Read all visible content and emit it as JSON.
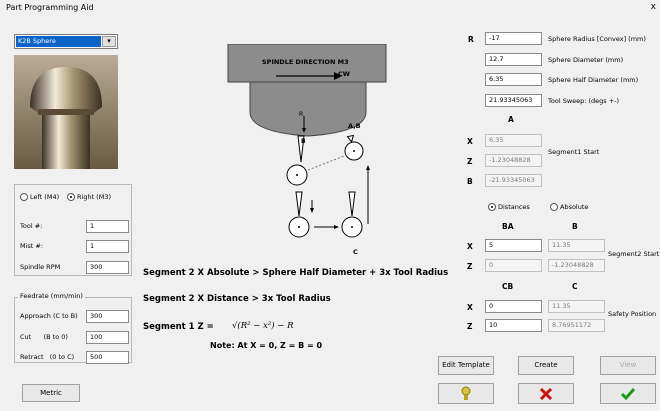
{
  "window": {
    "title": "Part Programming Aid",
    "close_glyph": "x"
  },
  "tool_select": {
    "value": "K2B Sphere"
  },
  "left_panel": {
    "left_radio": "Left (M4)",
    "right_radio": "Right (M3)",
    "fields": [
      {
        "label": "Tool #:",
        "value": "1"
      },
      {
        "label": "Mist #:",
        "value": "1"
      },
      {
        "label": "Spindle RPM",
        "value": "300"
      }
    ],
    "feedrate": {
      "title": "Feedrate (mm/min)",
      "rows": [
        {
          "label": "Approach (C to B)",
          "value": "300"
        },
        {
          "label": "Cut      (B to 0)",
          "value": "100"
        },
        {
          "label": "Retract   (0 to C)",
          "value": "500"
        }
      ]
    },
    "metric_button": "Metric"
  },
  "diagram": {
    "spindle_label": "SPINDLE DIRECTION  M3",
    "cw": "CW",
    "r": "R",
    "b": "B",
    "ab": "A,B",
    "c": "C"
  },
  "formulas": {
    "f1": "Segment 2 X Absolute  >  Sphere Half Diameter + 3x Tool Radius",
    "f2": "Segment 2 X Distance  >  3x Tool Radius",
    "f3_lhs": "Segment 1 Z   =",
    "f3_rhs": "√(R² − x²) − R",
    "note": "Note:  At X = 0,     Z = B = 0"
  },
  "right_panel": {
    "r_label": "R",
    "sphere_fields": [
      {
        "value": "-17",
        "label": "Sphere Radius [Convex] (mm)"
      },
      {
        "value": "12.7",
        "label": "Sphere Diameter (mm)"
      },
      {
        "value": "6.35",
        "label": "Sphere Half Diameter (mm)"
      },
      {
        "value": "21.93345063",
        "label": "Tool Sweep: (degs +-)"
      }
    ],
    "col_a": "A",
    "seg1": {
      "x": "6.35",
      "z": "-1.23048828",
      "b": "-21.93345063",
      "label": "Segment1 Start"
    },
    "axis_x": "X",
    "axis_z": "Z",
    "axis_b": "B",
    "distances": "Distances",
    "absolute": "Absolute",
    "col_ba": "BA",
    "col_b": "B",
    "seg2": {
      "x_ba": "5",
      "x_b": "11.35",
      "z_ba": "0",
      "z_b": "-1.23048828",
      "label": "Segment2 Start"
    },
    "col_cb": "CB",
    "col_c": "C",
    "safety": {
      "x_cb": "0",
      "x_c": "11.35",
      "z_cb": "10",
      "z_c": "8.76951172",
      "label": "Safety Position"
    }
  },
  "buttons": {
    "edit_template": "Edit Template",
    "create": "Create",
    "view": "View"
  },
  "colors": {
    "ok": "#1a9a1a",
    "cancel": "#d01010",
    "hint": "#d8c23a"
  }
}
